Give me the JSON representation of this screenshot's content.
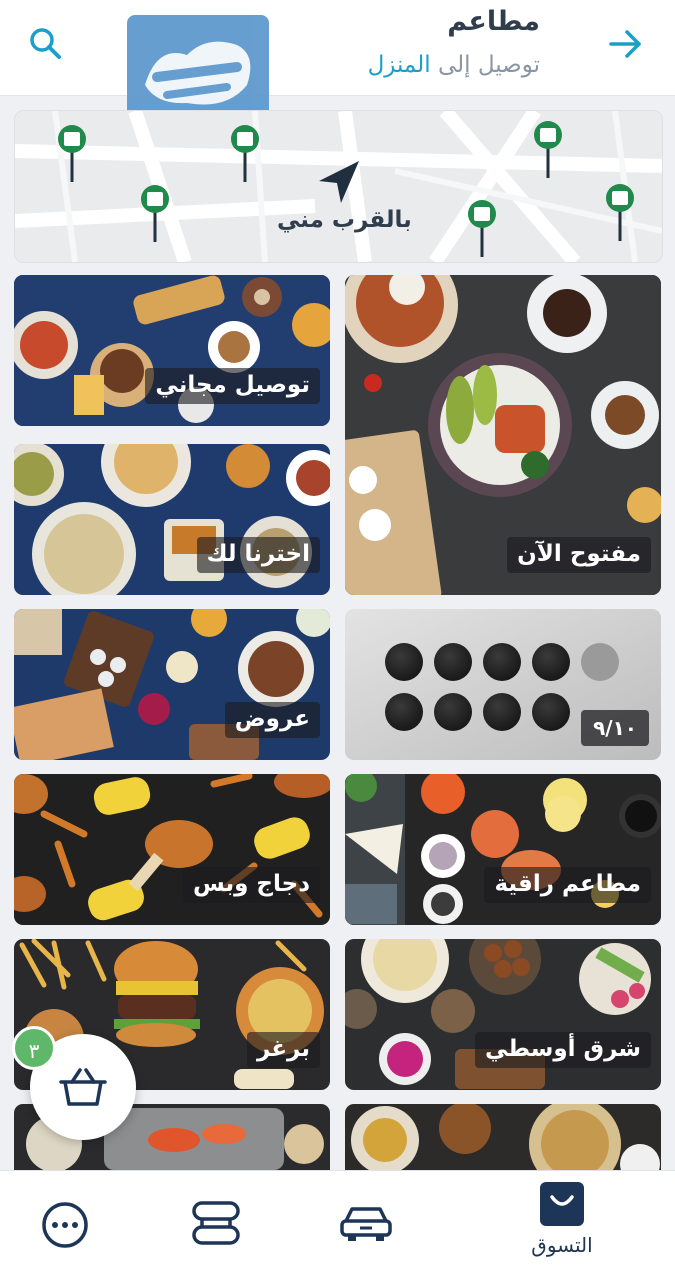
{
  "header": {
    "title": "مطاعم",
    "subtitle_prefix": "توصيل إلى",
    "subtitle_location": "المنزل"
  },
  "map": {
    "label": "بالقرب مني"
  },
  "tiles": {
    "free_delivery": "توصيل مجاني",
    "open_now": "مفتوح الآن",
    "our_picks": "اخترنا لك",
    "offers": "عروض",
    "carousel_page": "٩/١٠",
    "chicken": "دجاج وبس",
    "fine_dining": "مطاعم راقية",
    "burger": "برغر",
    "middle_eastern": "شرق أوسطي"
  },
  "cart": {
    "count": "٣"
  },
  "bottom_nav": {
    "shopping": "التسوق"
  },
  "colors": {
    "accent": "#1aa0c8",
    "primary": "#1d3557",
    "badge": "#5fb86a",
    "map_pin": "#1f8a4c"
  }
}
